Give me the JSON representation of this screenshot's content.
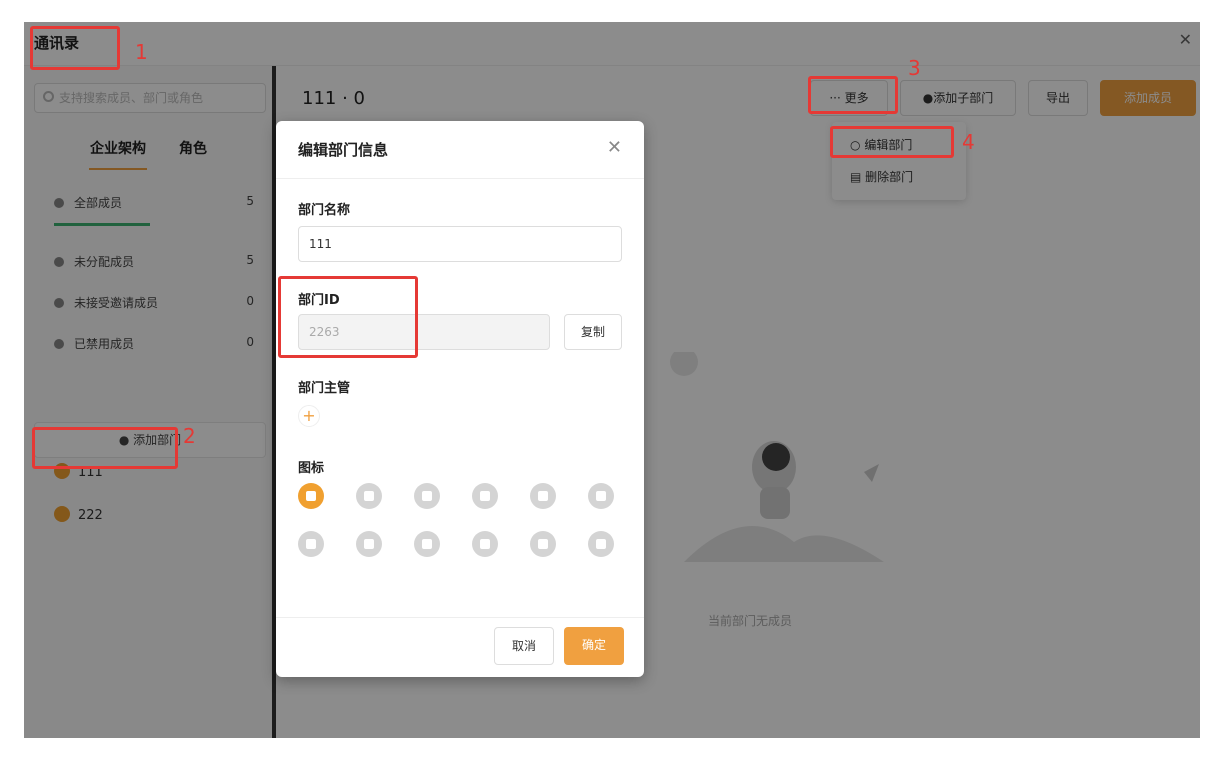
{
  "app": {
    "title": "通讯录"
  },
  "sidebar": {
    "search_placeholder": "支持搜索成员、部门或角色",
    "tabs": [
      "企业架构",
      "角色"
    ],
    "members": [
      {
        "label": "全部成员",
        "count": "5"
      },
      {
        "label": "未分配成员",
        "count": "5"
      },
      {
        "label": "未接受邀请成员",
        "count": "0"
      },
      {
        "label": "已禁用成员",
        "count": "0"
      }
    ],
    "add_dept_label": "添加部门",
    "departments": [
      "111",
      "222"
    ]
  },
  "main": {
    "title": "111 · 0",
    "buttons": {
      "more": "··· 更多",
      "add_sub": "添加子部门",
      "export": "导出",
      "add_member": "添加成员"
    },
    "dropdown": [
      "编辑部门",
      "删除部门"
    ],
    "empty_text": "当前部门无成员"
  },
  "modal": {
    "title": "编辑部门信息",
    "name_label": "部门名称",
    "name_value": "111",
    "id_label": "部门ID",
    "id_value": "2263",
    "copy_label": "复制",
    "manager_label": "部门主管",
    "icon_label": "图标",
    "cancel_label": "取消",
    "confirm_label": "确定"
  },
  "annotations": [
    "1",
    "2",
    "3",
    "4"
  ],
  "colors": {
    "accent": "#f0a040",
    "annotation": "#e53935"
  }
}
